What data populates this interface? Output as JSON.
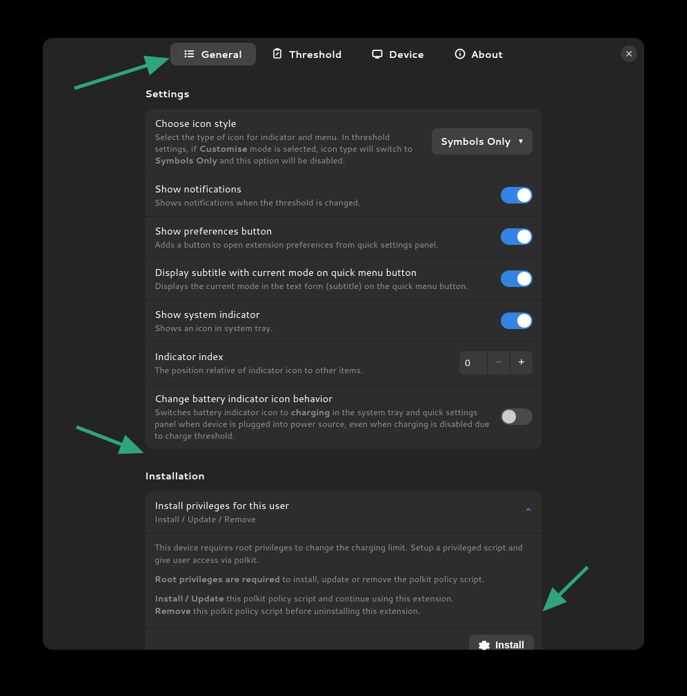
{
  "tabs": {
    "general": "General",
    "threshold": "Threshold",
    "device": "Device",
    "about": "About"
  },
  "sections": {
    "settings": "Settings",
    "installation": "Installation"
  },
  "rows": {
    "icon_style": {
      "title": "Choose icon style",
      "desc_pre": "Select the type of icon for indicator and menu.\nIn threshold settings, if ",
      "desc_bold1": "Customise",
      "desc_mid": " mode is selected, icon type will switch to ",
      "desc_bold2": "Symbols Only",
      "desc_post": " and this option will be disabled.",
      "dropdown_value": "Symbols Only"
    },
    "notifications": {
      "title": "Show notifications",
      "desc": "Shows notifications when the threshold is changed."
    },
    "prefs_button": {
      "title": "Show preferences button",
      "desc": "Adds a button to open extension preferences from quick settings panel."
    },
    "subtitle": {
      "title": "Display subtitle with current mode on quick menu button",
      "desc": "Displays the current mode in the text form (subtitle) on the quick menu button."
    },
    "sys_indicator": {
      "title": "Show system indicator",
      "desc": "Shows an icon in system tray."
    },
    "indicator_index": {
      "title": "Indicator index",
      "desc": "The position relative of indicator icon to other items.",
      "value": "0"
    },
    "battery_behavior": {
      "title": "Change battery indicator icon behavior",
      "desc_pre": "Switches battery indicator icon to ",
      "desc_bold": "charging",
      "desc_post": " in the system tray and quick settings panel when device is plugged into power source, even when charging is disabled due to charge threshold."
    }
  },
  "install": {
    "header_title": "Install privileges for this user",
    "header_sub": "Install / Update / Remove",
    "body_p1": "This device requires root privileges to change the charging limit. Setup a privileged script and give user access via polkit.",
    "body_p2_bold": "Root privileges are required",
    "body_p2_rest": " to install, update or remove the polkit policy script.",
    "body_p3a_bold": "Install / Update",
    "body_p3a_rest": "  this polkit policy script and continue using this extension.",
    "body_p3b_bold": "Remove",
    "body_p3b_rest": " this polkit policy script before uninstalling this extension.",
    "button": "Install"
  }
}
